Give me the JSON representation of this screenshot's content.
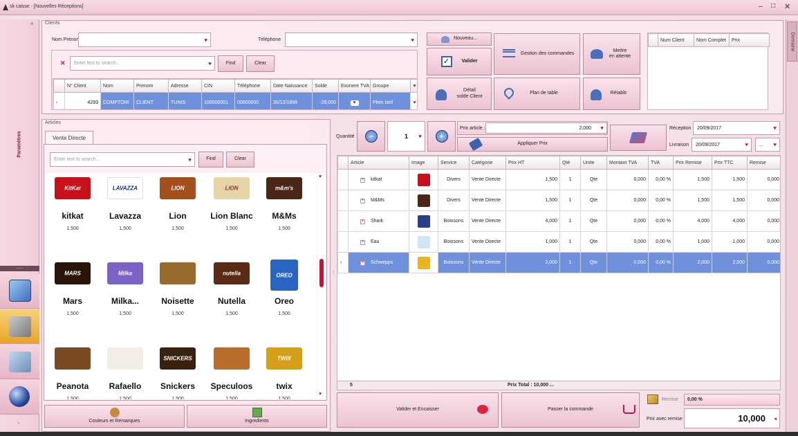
{
  "window": {
    "title": "sk caisse - [Nouvelles Réceptions]"
  },
  "sidebar": {
    "label": "Paramètres",
    "grip": "....."
  },
  "right_panel": {
    "label": "Domaine"
  },
  "clients": {
    "group_title": "Clients",
    "nom_label": "Nom Prénom",
    "tel_label": "Téléphone",
    "search_placeholder": "Enter text to search...",
    "find": "Find",
    "clear": "Clear",
    "columns": [
      "N° Client",
      "Nom",
      "Prenom",
      "Adresse",
      "CIN",
      "Téléphone",
      "Date Naissance",
      "Solde",
      "Exonere TVA",
      "Groupe"
    ],
    "row": {
      "num": "4293",
      "nom": "COMPTOIR",
      "prenom": "CLIENT",
      "adresse": "TUNIS",
      "cin": "100000001",
      "tel": "00000000",
      "naissance": "30/12/1899",
      "solde": "-28,000",
      "groupe": "Plein tarif"
    }
  },
  "actions": {
    "nouveau": "Nouveau...",
    "valider": "Valider",
    "gestion": "Gestion des commandes",
    "attente_1": "Mettre",
    "attente_2": "en attente",
    "detail_1": "Détail",
    "detail_2": "solde Client",
    "plan": "Plan de table",
    "retablir": "Rétablir"
  },
  "right_table": {
    "columns": [
      "Num Client",
      "Nom Complet",
      "Prix"
    ]
  },
  "articles": {
    "group_title": "Articles",
    "tab": "Vente Directe",
    "search_placeholder": "Enter text to search...",
    "find": "Find",
    "clear": "Clear",
    "products": [
      {
        "name": "kitkat",
        "price": "1,500",
        "color": "#c8101d",
        "logo": "KitKat"
      },
      {
        "name": "Lavazza",
        "price": "1,500",
        "color": "#ffffff",
        "logo": "LAVAZZA"
      },
      {
        "name": "Lion",
        "price": "1,500",
        "color": "#a4501c",
        "logo": "LION"
      },
      {
        "name": "Lion Blanc",
        "price": "1,500",
        "color": "#e7d3a8",
        "logo": "LION"
      },
      {
        "name": "M&Ms",
        "price": "1,500",
        "color": "#4a2616",
        "logo": "m&m's"
      },
      {
        "name": "Mars",
        "price": "1,500",
        "color": "#2a1408",
        "logo": "MARS"
      },
      {
        "name": "Milka...",
        "price": "1,500",
        "color": "#7b62c6",
        "logo": "Milka"
      },
      {
        "name": "Noisette",
        "price": "1,500",
        "color": "#9a6b2e",
        "logo": ""
      },
      {
        "name": "Nutella",
        "price": "1,500",
        "color": "#5a2a14",
        "logo": "nutella"
      },
      {
        "name": "Oreo",
        "price": "1,500",
        "color": "#2a64c2",
        "logo": "OREO"
      },
      {
        "name": "Peanota",
        "price": "1,500",
        "color": "#7a4a24",
        "logo": ""
      },
      {
        "name": "Rafaello",
        "price": "1,500",
        "color": "#f2eee6",
        "logo": ""
      },
      {
        "name": "Snickers",
        "price": "1,500",
        "color": "#3a200e",
        "logo": "SNICKERS"
      },
      {
        "name": "Speculoos",
        "price": "1,500",
        "color": "#b76e2c",
        "logo": ""
      },
      {
        "name": "twix",
        "price": "1,500",
        "color": "#d4a01a",
        "logo": "TWIX"
      }
    ],
    "couleurs": "Couleurs et Remarques",
    "ingredients": "Ingredients"
  },
  "order": {
    "quantite_label": "Quantité",
    "quantite": "1",
    "prix_article_label": "Prix article :",
    "prix_article": "2,000",
    "appliquer": "Appliquer Prix",
    "reception_label": "Réception",
    "reception": "20/09/2017",
    "livraison_label": "Livraison",
    "livraison": "20/09/2017",
    "more": "...",
    "columns": [
      "Article",
      "Image",
      "Service",
      "Catégorie",
      "Prix HT",
      "Qté",
      "Unite",
      "Montant TVA",
      "TVA",
      "Prix Remise",
      "Prix TTC",
      "Remise"
    ],
    "rows": [
      {
        "article": "kitkat",
        "service": "Divers",
        "categorie": "Vente Directe",
        "prix_ht": "1,500",
        "qte": "1",
        "unite": "Qte",
        "montant_tva": "0,000",
        "tva": "0,00 %",
        "prix_remise": "1,500",
        "prix_ttc": "1,500",
        "remise": "0,000",
        "color": "#c8101d"
      },
      {
        "article": "M&Ms",
        "service": "Divers",
        "categorie": "Vente Directe",
        "prix_ht": "1,500",
        "qte": "1",
        "unite": "Qte",
        "montant_tva": "0,000",
        "tva": "0,00 %",
        "prix_remise": "1,500",
        "prix_ttc": "1,500",
        "remise": "0,000",
        "color": "#4a2616"
      },
      {
        "article": "Shark",
        "service": "Boissons",
        "categorie": "Vente Directe",
        "prix_ht": "4,000",
        "qte": "1",
        "unite": "Qte",
        "montant_tva": "0,000",
        "tva": "0,00 %",
        "prix_remise": "4,000",
        "prix_ttc": "4,000",
        "remise": "0,000",
        "color": "#2a3f8c"
      },
      {
        "article": "Eau",
        "service": "Boissons",
        "categorie": "Vente Directe",
        "prix_ht": "1,000",
        "qte": "1",
        "unite": "Qte",
        "montant_tva": "0,000",
        "tva": "0,00 %",
        "prix_remise": "1,000",
        "prix_ttc": "1,000",
        "remise": "0,000",
        "color": "#cfe6f5"
      },
      {
        "article": "Schwepps",
        "service": "Boissons",
        "categorie": "Vente Directe",
        "prix_ht": "2,000",
        "qte": "1",
        "unite": "Qte",
        "montant_tva": "0,000",
        "tva": "0,00 %",
        "prix_remise": "2,000",
        "prix_ttc": "2,000",
        "remise": "0,000",
        "color": "#e9b620"
      }
    ],
    "footer_count": "5",
    "footer_total": "Prix Total : 10,000 ...",
    "valider_encaisser": "Valider et Encaisser",
    "passer": "Passer la commande",
    "remise_label": "Remise",
    "remise": "0,00 %",
    "prix_avec_remise_label": "Prix avec remise :",
    "prix_avec_remise": "10,000"
  }
}
